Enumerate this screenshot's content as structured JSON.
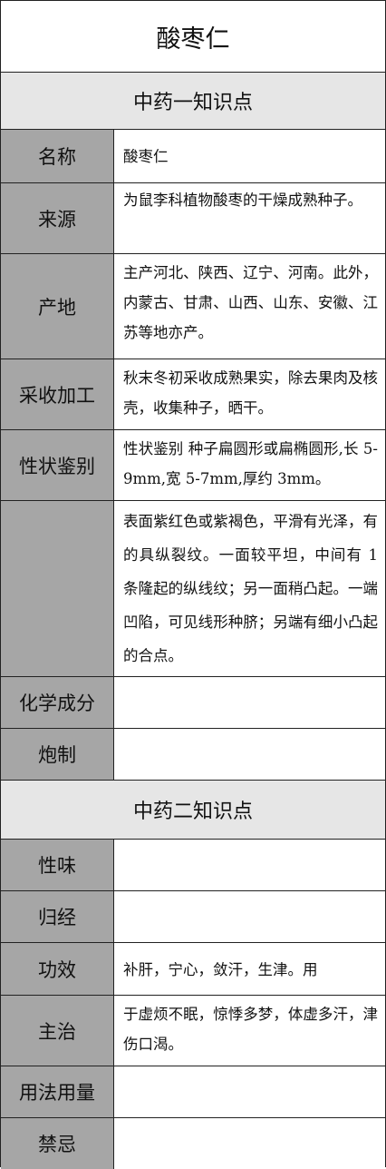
{
  "title": "酸枣仁",
  "section1": {
    "heading": "中药一知识点",
    "rows": [
      {
        "label": "名称",
        "value": "酸枣仁"
      },
      {
        "label": "来源",
        "value": "为鼠李科植物酸枣的干燥成熟种子。"
      },
      {
        "label": "产地",
        "value": "主产河北、陕西、辽宁、河南。此外，内蒙古、甘肃、山西、山东、安徽、江苏等地亦产。"
      },
      {
        "label": "采收加工",
        "value": "秋末冬初采收成熟果实，除去果肉及核壳，收集种子，晒干。"
      },
      {
        "label": "性状鉴别",
        "value": "性状鉴别 种子扁圆形或扁椭圆形,长 5-9mm,宽 5-7mm,厚约 3mm。"
      },
      {
        "label": "",
        "value": "表面紫红色或紫褐色，平滑有光泽，有的具纵裂纹。一面较平坦，中间有 1 条隆起的纵线纹；另一面稍凸起。一端凹陷，可见线形种脐；另端有细小凸起的合点。"
      },
      {
        "label": "化学成分",
        "value": ""
      },
      {
        "label": "炮制",
        "value": ""
      }
    ]
  },
  "section2": {
    "heading": "中药二知识点",
    "rows": [
      {
        "label": "性味",
        "value": ""
      },
      {
        "label": "归经",
        "value": ""
      },
      {
        "label": "功效",
        "value": "补肝，宁心，敛汗，生津。用"
      },
      {
        "label": "主治",
        "value": "于虚烦不眠，惊悸多梦，体虚多汗，津伤口渴。"
      },
      {
        "label": "用法用量",
        "value": ""
      },
      {
        "label": "禁忌",
        "value": ""
      }
    ]
  }
}
